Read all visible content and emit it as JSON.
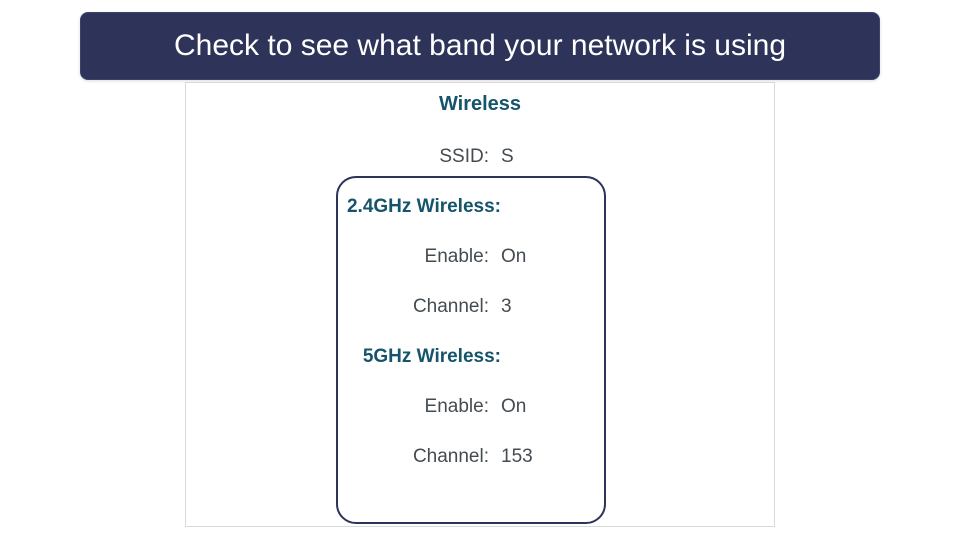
{
  "banner": {
    "text": "Check to see what band your network is using"
  },
  "panel": {
    "section_title": "Wireless",
    "ssid": {
      "label": "SSID:",
      "value": "S"
    },
    "band24": {
      "title": "2.4GHz Wireless:",
      "enable": {
        "label": "Enable:",
        "value": "On"
      },
      "channel": {
        "label": "Channel:",
        "value": "3"
      }
    },
    "band5": {
      "title": "5GHz Wireless:",
      "enable": {
        "label": "Enable:",
        "value": "On"
      },
      "channel": {
        "label": "Channel:",
        "value": "153"
      }
    }
  }
}
